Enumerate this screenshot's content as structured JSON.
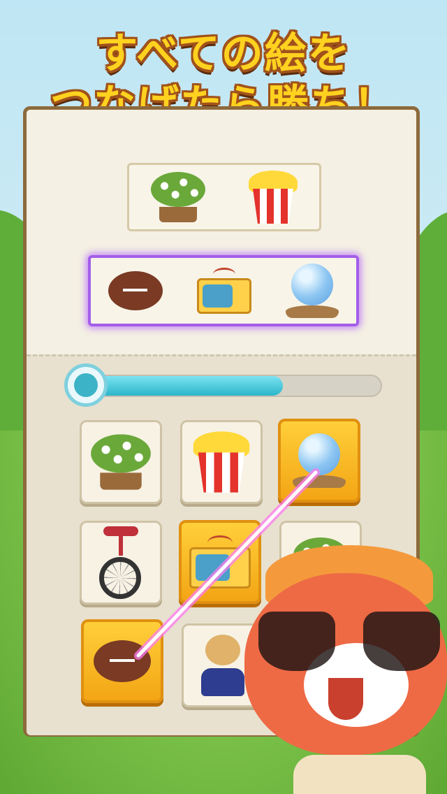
{
  "headline": {
    "line1": "すべての絵を",
    "line2": "つなげたら勝ち！"
  },
  "game": {
    "targets": [
      {
        "items": [
          "plant-icon",
          "popcorn-icon"
        ],
        "active": false
      },
      {
        "items": [
          "football-icon",
          "tv-icon",
          "crystal-ball-icon"
        ],
        "active": true
      }
    ],
    "timer_remaining": 0.66,
    "grid": [
      {
        "icon": "plant-icon",
        "selected": false
      },
      {
        "icon": "popcorn-icon",
        "selected": false
      },
      {
        "icon": "crystal-ball-icon",
        "selected": true
      },
      {
        "icon": "unicycle-icon",
        "selected": false
      },
      {
        "icon": "tv-icon",
        "selected": true
      },
      {
        "icon": "plant-icon",
        "selected": false
      },
      {
        "icon": "football-icon",
        "selected": true
      },
      {
        "icon": "teddy-bear-icon",
        "selected": false
      }
    ]
  },
  "colors": {
    "accent_gold": "#f3a514",
    "active_purple": "#a35ee8",
    "timer": "#2bb5c9",
    "headline": "#ffd21f"
  }
}
